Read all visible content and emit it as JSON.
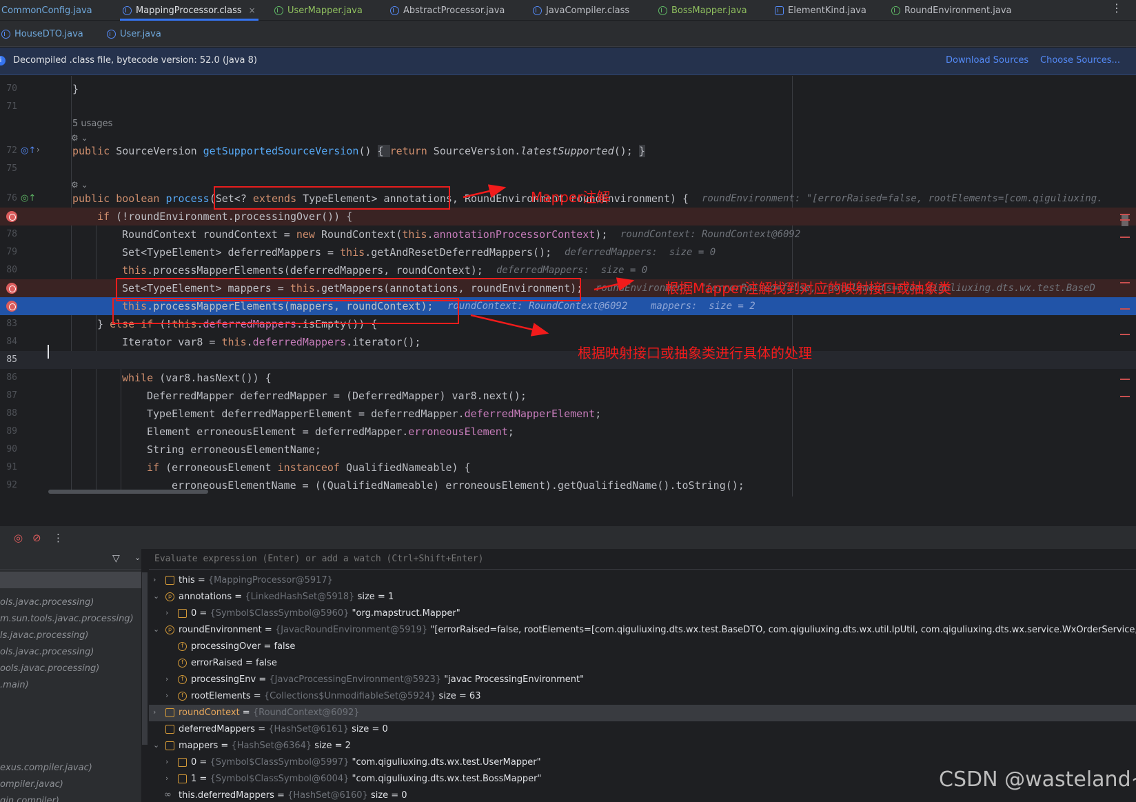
{
  "tabs_row1": [
    {
      "label": "CommonConfig.java",
      "kind": "class"
    },
    {
      "label": "MappingProcessor.class",
      "kind": "class",
      "active": true
    },
    {
      "label": "UserMapper.java",
      "kind": "interface"
    },
    {
      "label": "AbstractProcessor.java",
      "kind": "class"
    },
    {
      "label": "JavaCompiler.class",
      "kind": "class"
    },
    {
      "label": "BossMapper.java",
      "kind": "interface"
    },
    {
      "label": "ElementKind.java",
      "kind": "enum"
    },
    {
      "label": "RoundEnvironment.java",
      "kind": "interface"
    }
  ],
  "tabs_row2": [
    {
      "label": "HouseDTO.java",
      "kind": "class"
    },
    {
      "label": "User.java",
      "kind": "class"
    }
  ],
  "close_glyph": "×",
  "more_glyph": "⋮",
  "banner": {
    "text": "Decompiled .class file, bytecode version: 52.0 (Java 8)",
    "download": "Download Sources",
    "choose": "Choose Sources..."
  },
  "editor": {
    "line_numbers": {
      "l70": "70",
      "l71": "71",
      "l72": "72",
      "l75": "75",
      "l76": "76",
      "l78": "78",
      "l79": "79",
      "l80": "80",
      "l83": "83",
      "l84": "84",
      "l85": "85",
      "l86": "86",
      "l87": "87",
      "l88": "88",
      "l89": "89",
      "l90": "90",
      "l91": "91",
      "l92": "92"
    },
    "usages": "5 usages",
    "code": {
      "c70": "}",
      "c72a": "public ",
      "c72b": "SourceVersion ",
      "c72c": "getSupportedSourceVersion",
      "c72d": "() ",
      "c72e": "{ ",
      "c72f": "return",
      "c72g": " SourceVersion.",
      "c72h": "latestSupported",
      "c72i": "(); ",
      "c72j": "}",
      "c76a": "public boolean ",
      "c76b": "process",
      "c76c": "(Set<? ",
      "c76d": "extends",
      "c76e": " TypeElement> annotations, RoundEnvironment roundEnvironment) {",
      "c77a": "if",
      "c77b": " (!roundEnvironment.processingOver()) {",
      "c78a": "RoundContext roundContext = ",
      "c78b": "new",
      "c78c": " RoundContext(",
      "c78d": "this",
      "c78e": ".",
      "c78f": "annotationProcessorContext",
      "c78g": ");",
      "c79a": "Set<TypeElement> deferredMappers = ",
      "c79b": "this",
      "c79c": ".getAndResetDeferredMappers();",
      "c80a": "this",
      "c80b": ".processMapperElements(deferredMappers, roundContext);",
      "c81a": "Set<TypeElement> mappers = ",
      "c81b": "this",
      "c81c": ".getMappers(annotations, roundEnvironment);",
      "c82a": "this",
      "c82b": ".processMapperElements(mappers, roundContext);",
      "c83a": "} ",
      "c83b": "else if",
      "c83c": " (!",
      "c83d": "this",
      "c83e": ".",
      "c83f": "deferredMappers",
      "c83g": ".isEmpty()) {",
      "c84a": "Iterator var8 = ",
      "c84b": "this",
      "c84c": ".",
      "c84d": "deferredMappers",
      "c84e": ".iterator();",
      "c86a": "while",
      "c86b": " (var8.hasNext()) {",
      "c87": "DeferredMapper deferredMapper = (DeferredMapper) var8.next();",
      "c88a": "TypeElement deferredMapperElement = deferredMapper.",
      "c88b": "deferredMapperElement",
      "c88c": ";",
      "c89a": "Element erroneousElement = deferredMapper.",
      "c89b": "erroneousElement",
      "c89c": ";",
      "c90": "String erroneousElementName;",
      "c91a": "if",
      "c91b": " (erroneousElement ",
      "c91c": "instanceof",
      "c91d": " QualifiedNameable) {",
      "c92": "erroneousElementName = ((QualifiedNameable) erroneousElement).getQualifiedName().toString();"
    },
    "hints": {
      "h76": "roundEnvironment: \"[errorRaised=false, rootElements=[com.qiguliuxing.",
      "h78": "roundContext: RoundContext@6092",
      "h79": "deferredMappers:  size = 0",
      "h80": "deferredMappers:  size = 0",
      "h81": "roundEnvironment: \"[errorRaised=false, rootElements=[com.qiguliuxing.dts.wx.test.BaseD",
      "h82": "roundContext: RoundContext@6092    mappers:  size = 2"
    },
    "annotations": {
      "a1": "Mapper注解",
      "a2": "根据Mapper注解找到对应的映射接口或抽象类",
      "a3": "根据映射接口或抽象类进行具体的处理"
    }
  },
  "frames": [
    "ols.javac.processing)",
    "m.sun.tools.javac.processing)",
    "ls.javac.processing)",
    "ols.javac.processing)",
    "ools.javac.processing)",
    ".main)",
    "exus.compiler.javac)",
    "ompiler.javac)",
    "gin.compiler)"
  ],
  "eval_placeholder": "Evaluate expression (Enter) or add a watch (Ctrl+Shift+Enter)",
  "variables": {
    "v1": {
      "name": "this",
      "eq": " = ",
      "type": "{MappingProcessor@5917}",
      "value": ""
    },
    "v2": {
      "name": "annotations",
      "eq": " = ",
      "type": "{LinkedHashSet@5918}",
      "value": "  size = 1"
    },
    "v3": {
      "name": "0",
      "eq": " = ",
      "type": "{Symbol$ClassSymbol@5960}",
      "value": " \"org.mapstruct.Mapper\""
    },
    "v4": {
      "name": "roundEnvironment",
      "eq": " = ",
      "type": "{JavacRoundEnvironment@5919}",
      "value": " \"[errorRaised=false, rootElements=[com.qiguliuxing.dts.wx.test.BaseDTO, com.qiguliuxing.dts.wx.util.IpUtil, com.qiguliuxing.dts.wx.service.WxOrderService, com.qigu"
    },
    "v5": {
      "name": "processingOver",
      "eq": " = ",
      "type": "",
      "value": "false"
    },
    "v6": {
      "name": "errorRaised",
      "eq": " = ",
      "type": "",
      "value": "false"
    },
    "v7": {
      "name": "processingEnv",
      "eq": " = ",
      "type": "{JavacProcessingEnvironment@5923}",
      "value": " \"javac ProcessingEnvironment\""
    },
    "v8": {
      "name": "rootElements",
      "eq": " = ",
      "type": "{Collections$UnmodifiableSet@5924}",
      "value": "  size = 63"
    },
    "v9": {
      "name": "roundContext",
      "eq": " = ",
      "type": "{RoundContext@6092}",
      "value": ""
    },
    "v10": {
      "name": "deferredMappers",
      "eq": " = ",
      "type": "{HashSet@6161}",
      "value": "  size = 0"
    },
    "v11": {
      "name": "mappers",
      "eq": " = ",
      "type": "{HashSet@6364}",
      "value": "  size = 2"
    },
    "v12": {
      "name": "0",
      "eq": " = ",
      "type": "{Symbol$ClassSymbol@5997}",
      "value": " \"com.qiguliuxing.dts.wx.test.UserMapper\""
    },
    "v13": {
      "name": "1",
      "eq": " = ",
      "type": "{Symbol$ClassSymbol@6004}",
      "value": " \"com.qiguliuxing.dts.wx.test.BossMapper\""
    },
    "v14": {
      "name": "this.deferredMappers",
      "eq": " = ",
      "type": "{HashSet@6160}",
      "value": "  size = 0"
    }
  },
  "watermark": "CSDN @wasteland~",
  "colors": {
    "accent": "#3574f0",
    "breakpoint": "#db5c5c",
    "annotation": "#f21b1b",
    "exec_line": "#2154a8"
  }
}
